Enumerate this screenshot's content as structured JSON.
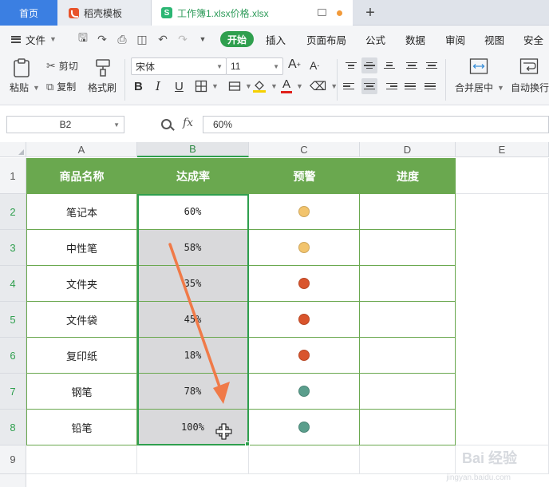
{
  "tabs": {
    "home": "首页",
    "template": "稻壳模板",
    "workbook_icon": "S",
    "workbook": "工作簿1.xlsx价格.xlsx",
    "new_tab": "+"
  },
  "menu": {
    "file": "文件",
    "items": [
      "开始",
      "插入",
      "页面布局",
      "公式",
      "数据",
      "审阅",
      "视图",
      "安全"
    ]
  },
  "ribbon": {
    "paste": "粘贴",
    "cut": "剪切",
    "copy": "复制",
    "format_painter": "格式刷",
    "font_name": "宋体",
    "font_size": "11",
    "bold": "B",
    "italic": "I",
    "underline": "U",
    "merge_center": "合并居中",
    "wrap_text": "自动换行"
  },
  "formula_bar": {
    "name_box": "B2",
    "fx": "fx",
    "content": "60%"
  },
  "columns": [
    "A",
    "B",
    "C",
    "D",
    "E"
  ],
  "rows": [
    "1",
    "2",
    "3",
    "4",
    "5",
    "6",
    "7",
    "8",
    "9"
  ],
  "table": {
    "headers": [
      "商品名称",
      "达成率",
      "预警",
      "进度"
    ],
    "rows": [
      {
        "name": "笔记本",
        "rate": "60%",
        "warn_color": "#f2c46d"
      },
      {
        "name": "中性笔",
        "rate": "58%",
        "warn_color": "#f2c46d"
      },
      {
        "name": "文件夹",
        "rate": "35%",
        "warn_color": "#d9542c"
      },
      {
        "name": "文件袋",
        "rate": "45%",
        "warn_color": "#d9542c"
      },
      {
        "name": "复印纸",
        "rate": "18%",
        "warn_color": "#d9542c"
      },
      {
        "name": "钢笔",
        "rate": "78%",
        "warn_color": "#5a9e8c"
      },
      {
        "name": "铅笔",
        "rate": "100%",
        "warn_color": "#5a9e8c"
      }
    ]
  },
  "annotation": {
    "arrow_color": "#f07a48"
  },
  "watermark": {
    "line1": "Bai 经验",
    "line2": "jingyan.baidu.com"
  },
  "colors": {
    "accent_green": "#2f9f4e",
    "header_green": "#6aa84f",
    "home_tab_blue": "#3b7fe2"
  }
}
